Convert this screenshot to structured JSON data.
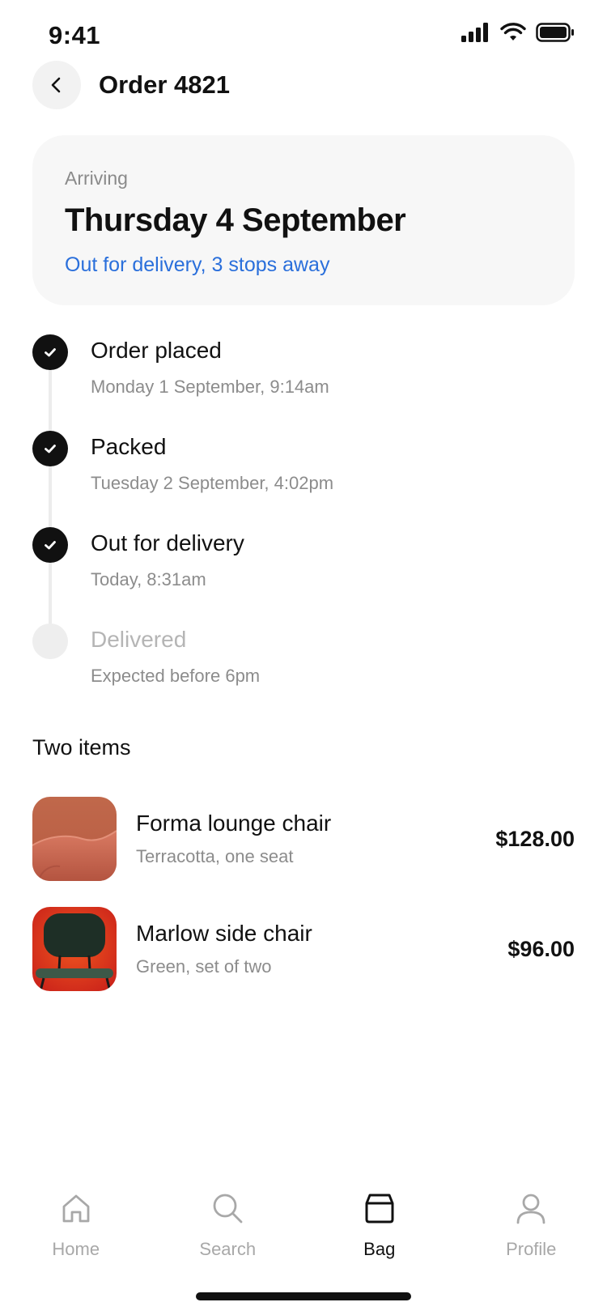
{
  "status_bar": {
    "time": "9:41",
    "icons": [
      "cellular-signal-icon",
      "wifi-icon",
      "battery-icon"
    ]
  },
  "header": {
    "title": "Order 4821",
    "back_icon": "chevron-left-icon"
  },
  "arrival": {
    "label": "Arriving",
    "date": "Thursday 4 September",
    "status": "Out for delivery, 3 stops away"
  },
  "timeline": {
    "steps": [
      {
        "title": "Order placed",
        "subtitle": "Monday 1 September, 9:14am",
        "done": true
      },
      {
        "title": "Packed",
        "subtitle": "Tuesday 2 September, 4:02pm",
        "done": true
      },
      {
        "title": "Out for delivery",
        "subtitle": "Today, 8:31am",
        "done": true
      },
      {
        "title": "Delivered",
        "subtitle": "Expected before 6pm",
        "done": false
      }
    ]
  },
  "items": {
    "title": "Two items",
    "list": [
      {
        "name": "Forma lounge chair",
        "description": "Terracotta, one seat",
        "price": "$128.00"
      },
      {
        "name": "Marlow side chair",
        "description": "Green, set of two",
        "price": "$96.00"
      }
    ]
  },
  "tabs": [
    {
      "label": "Home",
      "icon": "home-icon",
      "active": false
    },
    {
      "label": "Search",
      "icon": "search-icon",
      "active": false
    },
    {
      "label": "Bag",
      "icon": "bag-icon",
      "active": true
    },
    {
      "label": "Profile",
      "icon": "profile-icon",
      "active": false
    }
  ],
  "colors": {
    "accent": "#2a6fdb",
    "text": "#111111",
    "muted": "#8c8c8c",
    "card": "#f7f7f7"
  }
}
